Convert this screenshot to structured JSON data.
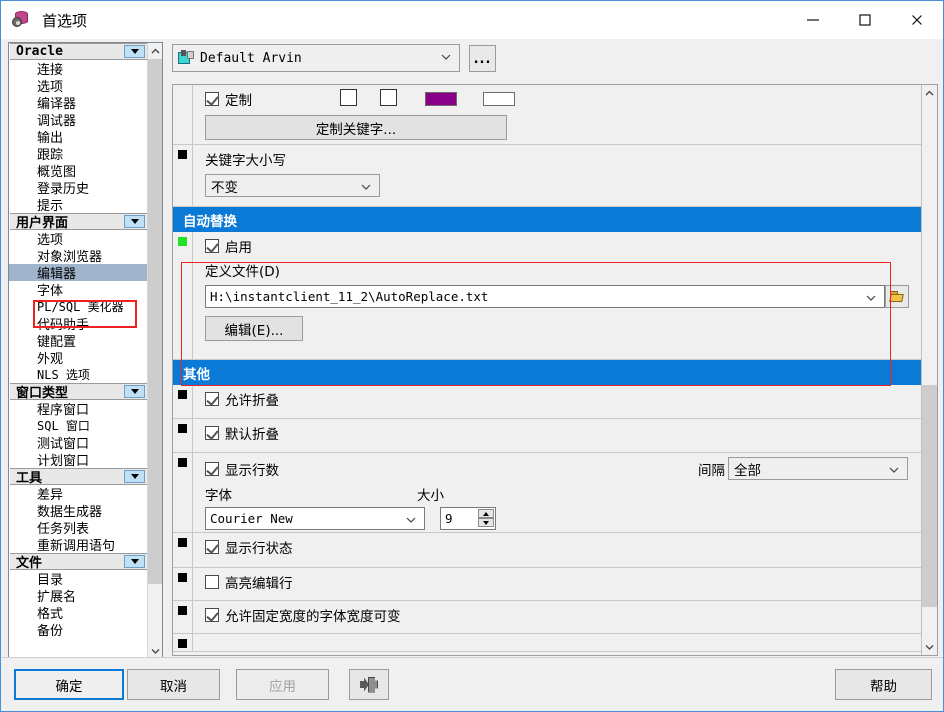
{
  "window": {
    "title": "首选项",
    "icon": "database-preferences-icon",
    "controls": {
      "minimize": "minimize-icon",
      "maximize": "maximize-icon",
      "close": "close-icon"
    }
  },
  "profile": {
    "icon": "profile-icon",
    "value": "Default Arvin",
    "more_label": "..."
  },
  "tree": {
    "groups": [
      {
        "label": "Oracle",
        "mono": true,
        "items": [
          "连接",
          "选项",
          "编译器",
          "调试器",
          "输出",
          "跟踪",
          "概览图",
          "登录历史",
          "提示"
        ]
      },
      {
        "label": "用户界面",
        "mono": false,
        "items": [
          "选项",
          "对象浏览器",
          "编辑器",
          "字体",
          "PL/SQL 美化器",
          "代码助手",
          "键配置",
          "外观",
          "NLS 选项"
        ]
      },
      {
        "label": "窗口类型",
        "mono": false,
        "items": [
          "程序窗口",
          "SQL 窗口",
          "测试窗口",
          "计划窗口"
        ]
      },
      {
        "label": "工具",
        "mono": false,
        "items": [
          "差异",
          "数据生成器",
          "任务列表",
          "重新调用语句"
        ]
      },
      {
        "label": "文件",
        "mono": false,
        "items": [
          "目录",
          "扩展名",
          "格式",
          "备份"
        ]
      }
    ],
    "selected": "编辑器"
  },
  "content": {
    "custom_row": {
      "checkbox_label": "定制",
      "checkbox_checked": true,
      "extra_checkbox_1_checked": false,
      "extra_checkbox_2_checked": false,
      "color_swatch_1": "#880088",
      "color_swatch_2": "#ffffff",
      "button_label": "定制关键字..."
    },
    "keyword_case": {
      "label": "关键字大小写",
      "value": "不变"
    },
    "autoreplace": {
      "header": "自动替换",
      "enable_label": "启用",
      "enable_checked": true,
      "file_label": "定义文件(D)",
      "file_value": "H:\\instantclient_11_2\\AutoReplace.txt",
      "browse_icon": "folder-open-icon",
      "edit_button": "编辑(E)..."
    },
    "other": {
      "header": "其他",
      "rows": [
        {
          "label": "允许折叠",
          "checked": true
        },
        {
          "label": "默认折叠",
          "checked": true
        },
        {
          "label": "显示行数",
          "checked": true
        },
        {
          "label": "显示行状态",
          "checked": true
        },
        {
          "label": "高亮编辑行",
          "checked": false
        },
        {
          "label": "允许固定宽度的字体宽度可变",
          "checked": true
        }
      ],
      "interval_label": "间隔",
      "interval_value": "全部",
      "font_label": "字体",
      "font_value": "Courier New",
      "size_label": "大小",
      "size_value": "9"
    }
  },
  "footer": {
    "ok": "确定",
    "cancel": "取消",
    "apply": "应用",
    "migrate_icon": "migrate-settings-icon",
    "help": "帮助"
  },
  "colors": {
    "section_header": "#0b7ad6",
    "selection": "#a0b4cc",
    "annotation": "#ee2222",
    "marker_green": "#22e022"
  }
}
